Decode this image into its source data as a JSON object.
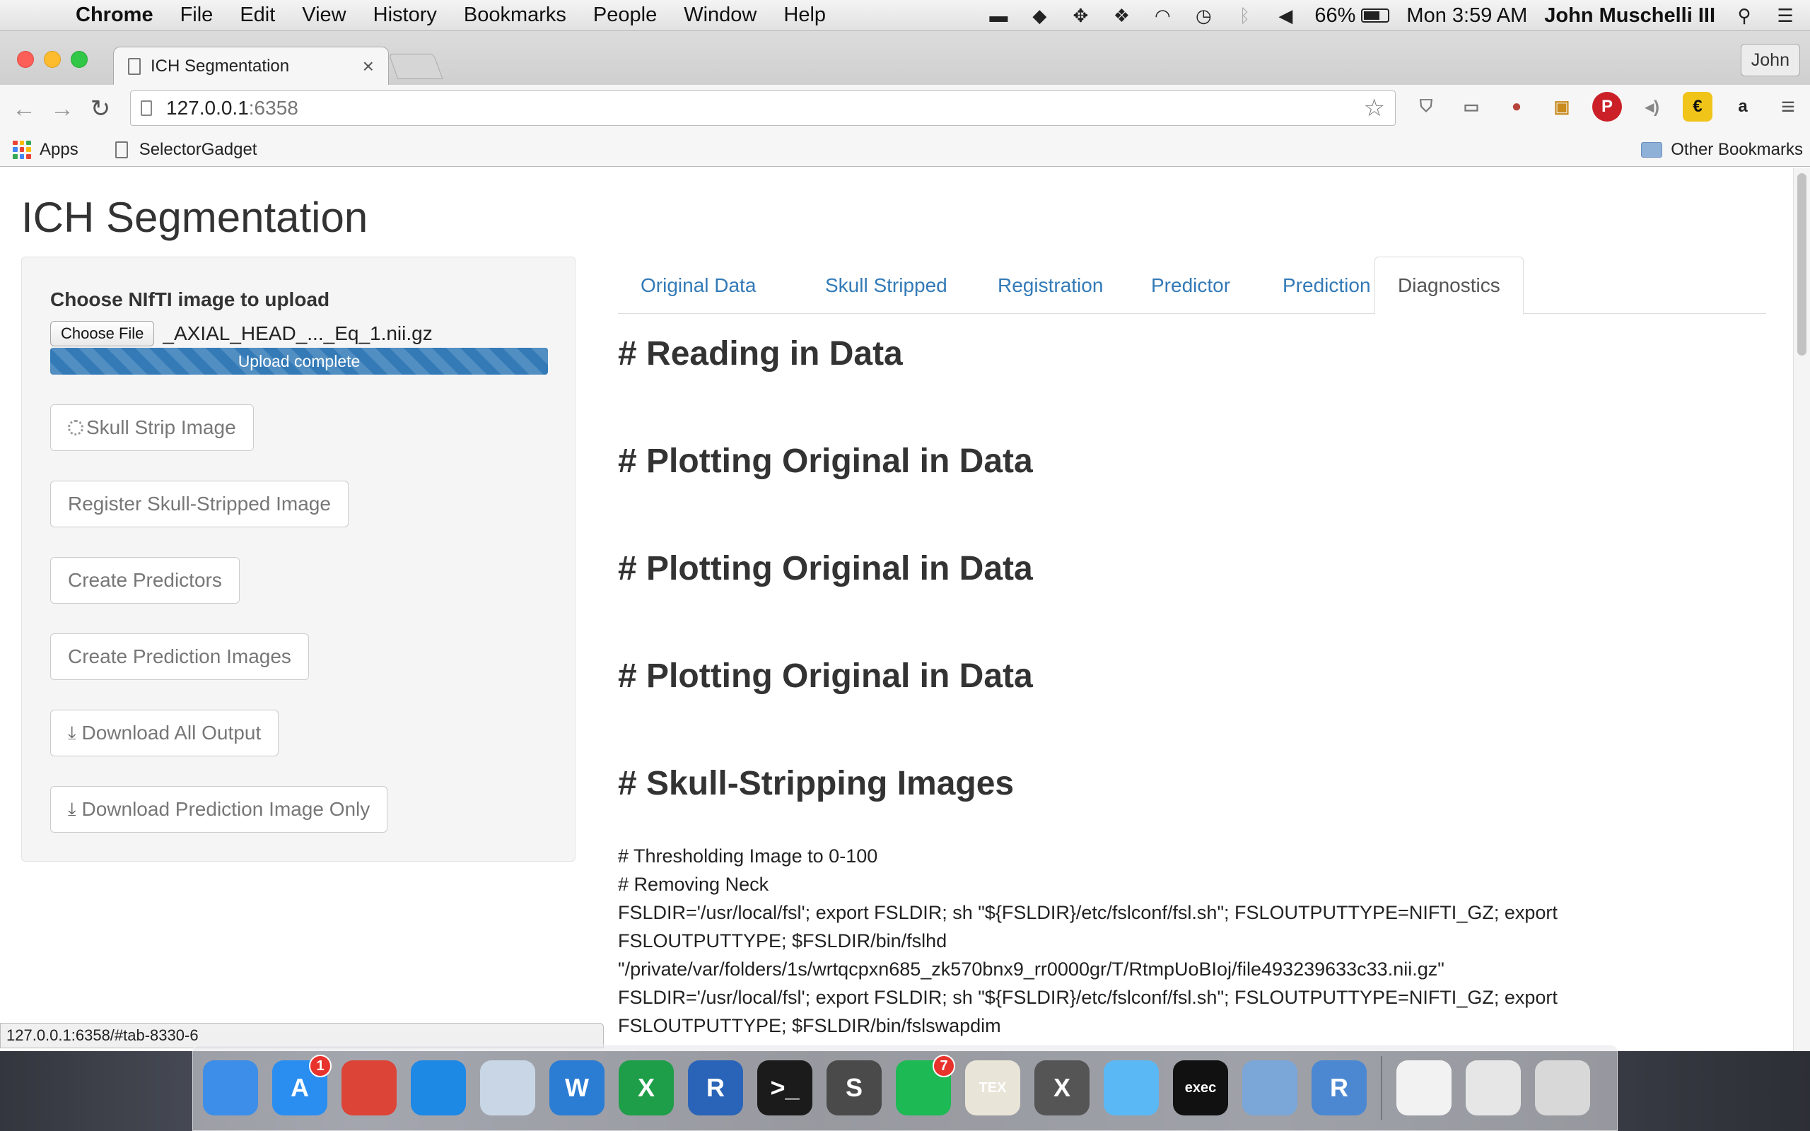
{
  "menubar": {
    "app_name": "Chrome",
    "menus": [
      "File",
      "Edit",
      "View",
      "History",
      "Bookmarks",
      "People",
      "Window",
      "Help"
    ],
    "battery_percent": "66%",
    "battery_level": 0.66,
    "clock": "Mon 3:59 AM",
    "user": "John Muschelli III"
  },
  "browser": {
    "tab_title": "ICH Segmentation",
    "tab_close": "×",
    "profile": "John",
    "url_host": "127.0.0.1",
    "url_port": ":6358",
    "bookmarks": {
      "apps": "Apps",
      "selector_gadget": "SelectorGadget",
      "other": "Other Bookmarks"
    },
    "extensions": [
      "ublock-icon",
      "cast-icon",
      "tomato-icon",
      "clipboard-icon",
      "pinterest-icon",
      "audio-icon",
      "evernote-icon",
      "amazon-icon",
      "menu-icon"
    ],
    "status_url": "127.0.0.1:6358/#tab-8330-6"
  },
  "app": {
    "title": "ICH Segmentation",
    "sidebar": {
      "upload_label": "Choose NIfTI image to upload",
      "choose_file": "Choose File",
      "file_name": "_AXIAL_HEAD_..._Eq_1.nii.gz",
      "progress_text": "Upload complete",
      "progress_value": 1.0,
      "buttons": {
        "skull_strip": "Skull Strip Image",
        "register": "Register Skull-Stripped Image",
        "predictors": "Create Predictors",
        "prediction": "Create Prediction Images",
        "download_all": "Download All Output",
        "download_pred": "Download Prediction Image Only"
      }
    },
    "tabs": [
      "Original Data",
      "Skull Stripped",
      "Registration",
      "Predictor",
      "Prediction",
      "Diagnostics"
    ],
    "active_tab": "Diagnostics",
    "headings": [
      "# Reading in Data",
      "# Plotting Original in Data",
      "# Plotting Original in Data",
      "# Plotting Original in Data",
      "# Skull-Stripping Images"
    ],
    "log_lines": [
      "# Thresholding Image to 0-100",
      "# Removing Neck",
      "FSLDIR='/usr/local/fsl'; export FSLDIR; sh \"${FSLDIR}/etc/fslconf/fsl.sh\"; FSLOUTPUTTYPE=NIFTI_GZ; export",
      "FSLOUTPUTTYPE; $FSLDIR/bin/fslhd",
      "\"/private/var/folders/1s/wrtqcpxn685_zk570bnx9_rr0000gr/T/RtmpUoBIoj/file493239633c33.nii.gz\"",
      "FSLDIR='/usr/local/fsl'; export FSLDIR; sh \"${FSLDIR}/etc/fslconf/fsl.sh\"; FSLOUTPUTTYPE=NIFTI_GZ; export",
      "FSLOUTPUTTYPE; $FSLDIR/bin/fslswapdim"
    ]
  },
  "dock": {
    "apps": [
      {
        "name": "finder-icon",
        "color": "#3d8ee8",
        "glyph": ""
      },
      {
        "name": "app-store-icon",
        "color": "#2a8ef0",
        "glyph": "A",
        "badge": "1"
      },
      {
        "name": "chrome-icon",
        "color": "#db4437",
        "glyph": ""
      },
      {
        "name": "safari-icon",
        "color": "#1e88e5",
        "glyph": ""
      },
      {
        "name": "preview-icon",
        "color": "#c9d6e6",
        "glyph": ""
      },
      {
        "name": "word-icon",
        "color": "#2b7cd3",
        "glyph": "W"
      },
      {
        "name": "excel-icon",
        "color": "#1e9e48",
        "glyph": "X"
      },
      {
        "name": "r-app-icon",
        "color": "#2a64b8",
        "glyph": "R"
      },
      {
        "name": "terminal-icon",
        "color": "#1b1b1b",
        "glyph": ">_"
      },
      {
        "name": "sublime-icon",
        "color": "#4a4a4a",
        "glyph": "S"
      },
      {
        "name": "spotify-icon",
        "color": "#1db954",
        "glyph": "",
        "badge": "7"
      },
      {
        "name": "tex-icon",
        "color": "#e9e4d8",
        "glyph": "TEX"
      },
      {
        "name": "x11-icon",
        "color": "#555",
        "glyph": "X"
      },
      {
        "name": "messages-icon",
        "color": "#5ab8f5",
        "glyph": ""
      },
      {
        "name": "exec-icon",
        "color": "#111",
        "glyph": "exec"
      },
      {
        "name": "photos-icon",
        "color": "#7aa6d8",
        "glyph": ""
      },
      {
        "name": "rstudio-icon",
        "color": "#4c88d2",
        "glyph": "R"
      }
    ],
    "right_apps": [
      {
        "name": "document-icon",
        "color": "#f2f2f2",
        "glyph": ""
      },
      {
        "name": "downloads-stack-icon",
        "color": "#e6e6e6",
        "glyph": ""
      },
      {
        "name": "trash-icon",
        "color": "#d8d8d8",
        "glyph": ""
      }
    ]
  }
}
